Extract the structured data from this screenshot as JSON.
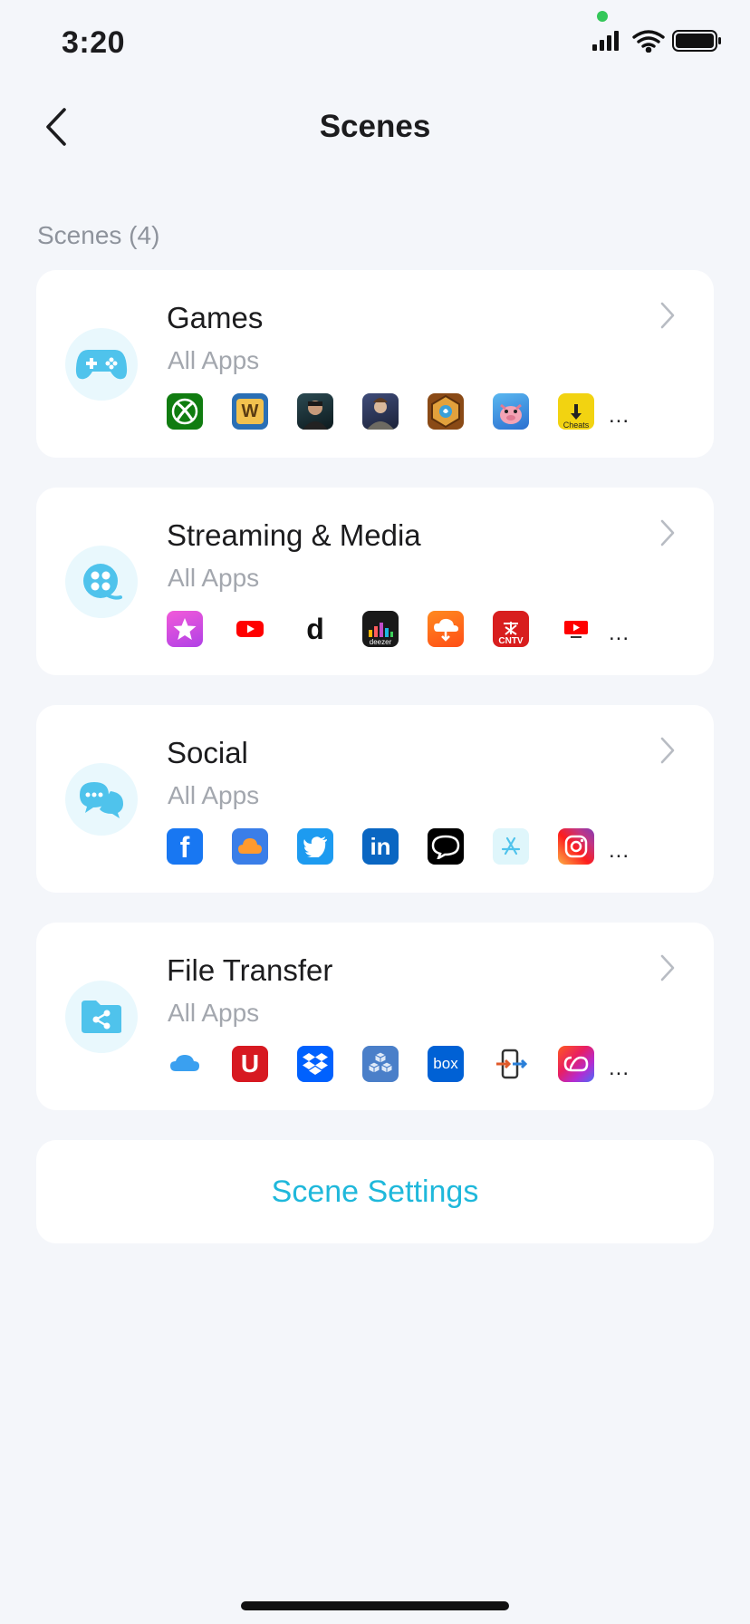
{
  "status": {
    "time": "3:20"
  },
  "nav": {
    "title": "Scenes",
    "back_icon": "chevron-left-icon"
  },
  "section": {
    "label": "Scenes (4)"
  },
  "colors": {
    "accent": "#1fb8db",
    "icon_bg": "#e9f8fd",
    "card_bg": "#ffffff",
    "page_bg": "#f4f6fa"
  },
  "scenes": [
    {
      "title": "Games",
      "subtitle": "All Apps",
      "icon": "gamepad-icon",
      "more": "...",
      "apps": [
        "xbox-icon",
        "words-with-friends-icon",
        "game-character-icon",
        "game-warrior-icon",
        "hearthstone-icon",
        "coin-master-icon",
        "cheats-icon"
      ]
    },
    {
      "title": "Streaming & Media",
      "subtitle": "All Apps",
      "icon": "film-reel-icon",
      "more": "...",
      "apps": [
        "itunes-star-icon",
        "youtube-icon",
        "dailymotion-icon",
        "deezer-icon",
        "soundcloud-icon",
        "cntv-icon",
        "youtube-tv-icon"
      ]
    },
    {
      "title": "Social",
      "subtitle": "All Apps",
      "icon": "chat-bubbles-icon",
      "more": "...",
      "apps": [
        "facebook-icon",
        "cloud-app-icon",
        "twitter-icon",
        "linkedin-icon",
        "messenger-bubble-icon",
        "app-store-icon",
        "instagram-icon"
      ]
    },
    {
      "title": "File Transfer",
      "subtitle": "All Apps",
      "icon": "shared-folder-icon",
      "more": "...",
      "apps": [
        "icloud-icon",
        "u-app-icon",
        "dropbox-icon",
        "cubes-app-icon",
        "box-icon",
        "phone-transfer-icon",
        "creative-cloud-icon"
      ]
    }
  ],
  "app_labels": {
    "wordsw": "W",
    "dailymotion": "d",
    "deezer": "deezer",
    "cntv": "CNTV",
    "linkedin": "in",
    "box": "box",
    "u": "U",
    "facebook": "f",
    "cheats": "Cheats"
  },
  "settings": {
    "label": "Scene Settings"
  }
}
